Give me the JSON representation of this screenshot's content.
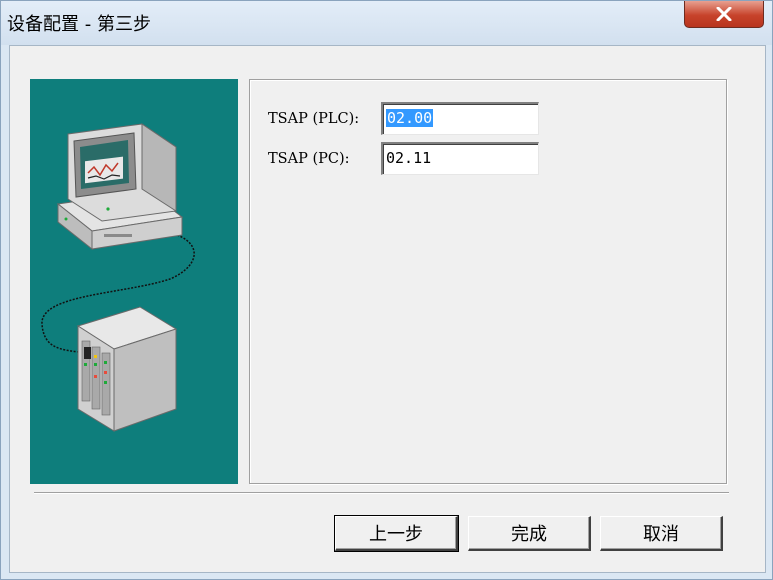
{
  "window": {
    "title": "设备配置 - 第三步",
    "close_icon": "close-icon"
  },
  "illustration": {
    "description_icon": "computer-and-plc-illustration",
    "background_color": "#0e7e7c"
  },
  "fields": [
    {
      "label": "TSAP (PLC):",
      "value": "02.00",
      "selected": true
    },
    {
      "label": "TSAP (PC):",
      "value": "02.11",
      "selected": false
    }
  ],
  "buttons": {
    "back": "上一步",
    "finish": "完成",
    "cancel": "取消"
  }
}
